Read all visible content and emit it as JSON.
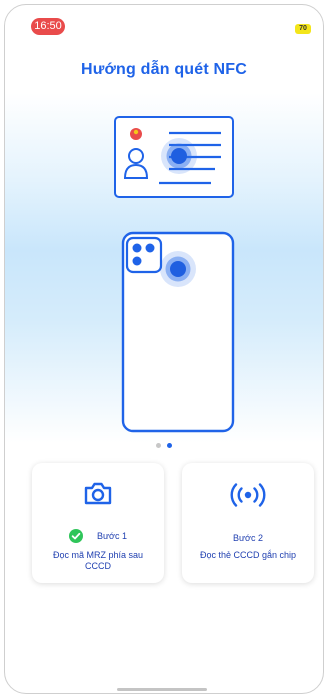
{
  "status_bar": {
    "time": "16:50",
    "battery": "70"
  },
  "header": {
    "title": "Hướng dẫn quét NFC"
  },
  "pagination": {
    "count": 2,
    "active_index": 1
  },
  "steps": [
    {
      "label": "Bước 1",
      "description": "Đọc mã MRZ phía sau CCCD",
      "icon": "camera-icon",
      "completed": true
    },
    {
      "label": "Bước 2",
      "description": "Đọc thẻ CCCD gắn chip",
      "icon": "nfc-icon",
      "completed": false
    }
  ],
  "colors": {
    "accent": "#1f63e8",
    "status_red": "#e94b4b",
    "success_green": "#2fc55a",
    "battery_yellow": "#f3e51a"
  }
}
